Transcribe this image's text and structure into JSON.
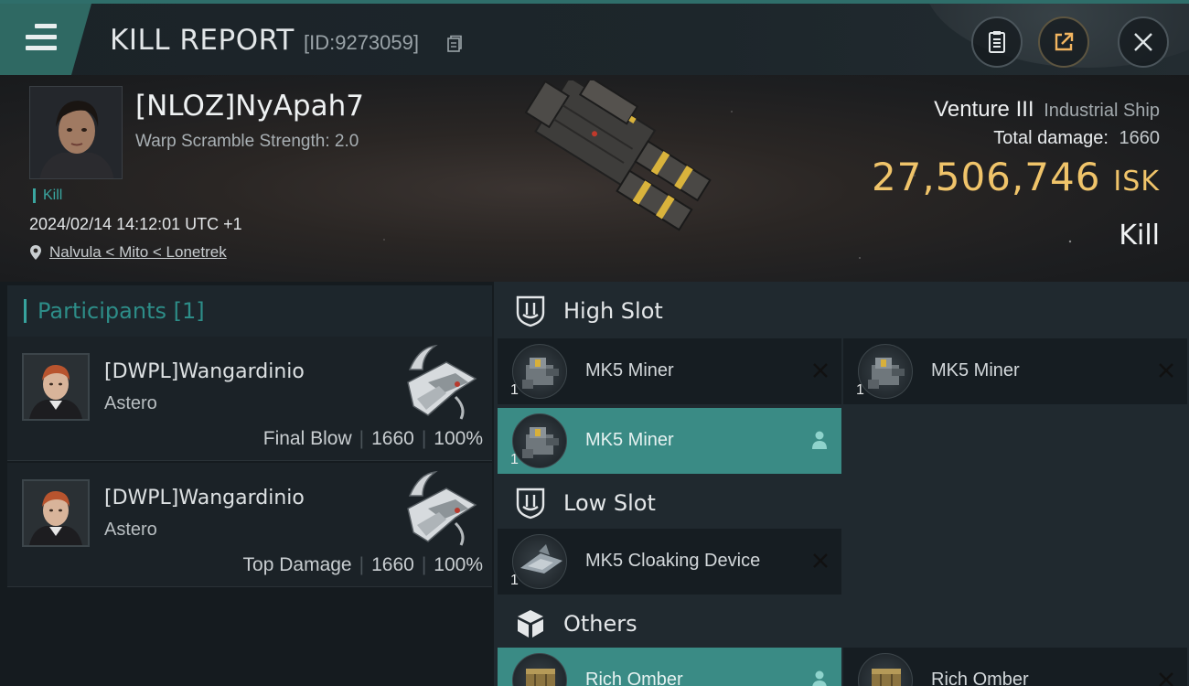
{
  "header": {
    "title": "KILL REPORT",
    "kill_id": "[ID:9273059]"
  },
  "victim": {
    "name": "[NLOZ]NyApah7",
    "warp_scramble": "Warp Scramble Strength: 2.0",
    "tag": "Kill",
    "timestamp": "2024/02/14 14:12:01 UTC +1",
    "location": "Nalvula < Mito < Lonetrek"
  },
  "ship": {
    "name": "Venture III",
    "class": "Industrial Ship",
    "total_damage_label": "Total damage:",
    "total_damage": "1660",
    "isk_value": "27,506,746",
    "isk_unit": "ISK",
    "result": "Kill"
  },
  "participants": {
    "label": "Participants [1]",
    "rows": [
      {
        "name": "[DWPL]Wangardinio",
        "ship": "Astero",
        "role": "Final Blow",
        "damage": "1660",
        "percent": "100%"
      },
      {
        "name": "[DWPL]Wangardinio",
        "ship": "Astero",
        "role": "Top Damage",
        "damage": "1660",
        "percent": "100%"
      }
    ]
  },
  "fitting": {
    "high_slot": {
      "label": "High Slot",
      "modules": [
        {
          "name": "MK5 Miner",
          "qty": "1"
        },
        {
          "name": "MK5 Miner",
          "qty": "1"
        },
        {
          "name": "MK5 Miner",
          "qty": "1"
        }
      ]
    },
    "low_slot": {
      "label": "Low Slot",
      "modules": [
        {
          "name": "MK5 Cloaking Device",
          "qty": "1"
        }
      ]
    },
    "others": {
      "label": "Others",
      "modules": [
        {
          "name": "Rich Omber"
        },
        {
          "name": "Rich Omber"
        }
      ]
    }
  },
  "colors": {
    "accent_teal": "#3a8b85",
    "isk_gold": "#f0c46a",
    "menu_teal": "#2f6963"
  },
  "icons": [
    "menu-icon",
    "copy-icon",
    "clipboard-icon",
    "share-icon",
    "close-icon",
    "location-pin-icon",
    "shield-slot-icon",
    "cube-icon",
    "remove-x-icon",
    "person-icon"
  ]
}
